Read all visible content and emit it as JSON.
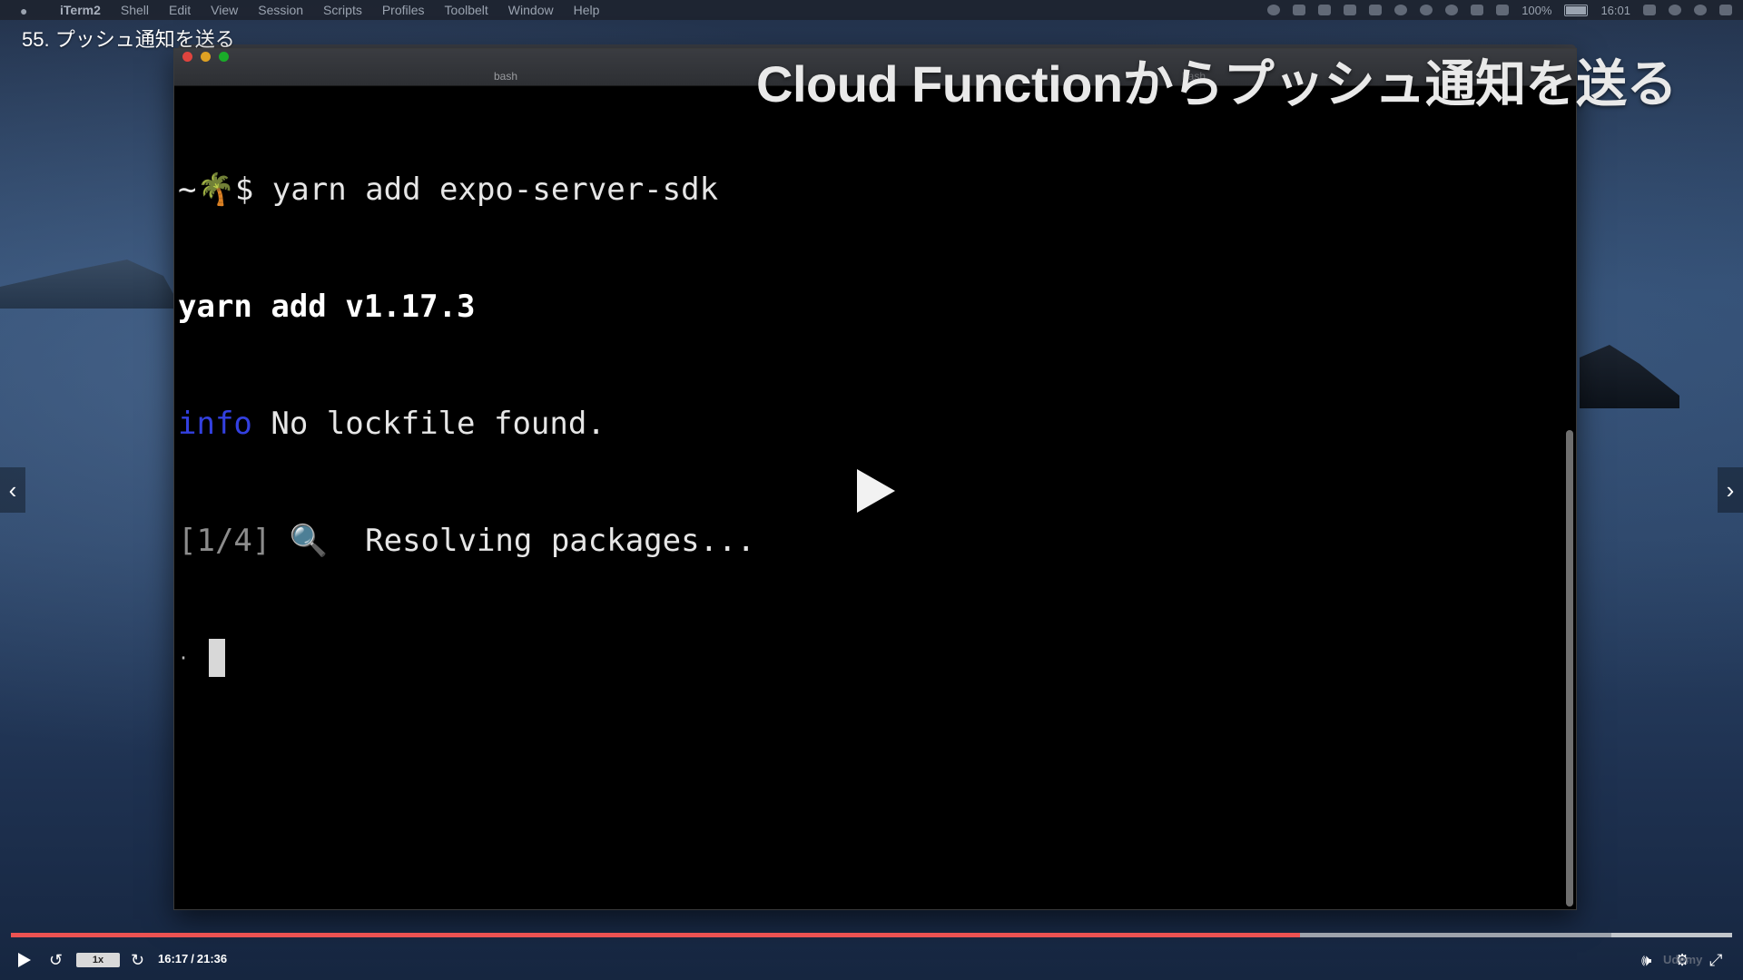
{
  "menubar": {
    "app_name": "iTerm2",
    "items": [
      "Shell",
      "Edit",
      "View",
      "Session",
      "Scripts",
      "Profiles",
      "Toolbelt",
      "Window",
      "Help"
    ],
    "battery": "100%",
    "clock": "16:01"
  },
  "lecture": {
    "title": "55. プッシュ通知を送る"
  },
  "overlay": {
    "heading": "Cloud Functionからプッシュ通知を送る"
  },
  "terminal": {
    "back_window_title": "bash",
    "tab_title": "bash",
    "tab_title_2": "bash",
    "lines": {
      "prompt_prefix": "~",
      "prompt_emoji": "🌴",
      "prompt_symbol": "$ ",
      "command": "yarn add expo-server-sdk",
      "version": "yarn add v1.17.3",
      "info_tag": "info",
      "info_text": " No lockfile found.",
      "step": "[1/4]",
      "step_emoji": "🔍",
      "step_text": "  Resolving packages...",
      "spinner": "·"
    }
  },
  "player": {
    "speed": "1x",
    "current_time": "16:17",
    "separator": "/",
    "total_time": "21:36",
    "progress_fraction": 0.7489,
    "buffered_fraction": 0.93,
    "watermark": "Udemy",
    "colors": {
      "progress": "#ec5252",
      "buffer": "#9da3ac",
      "track": "#c2c6cc"
    }
  }
}
